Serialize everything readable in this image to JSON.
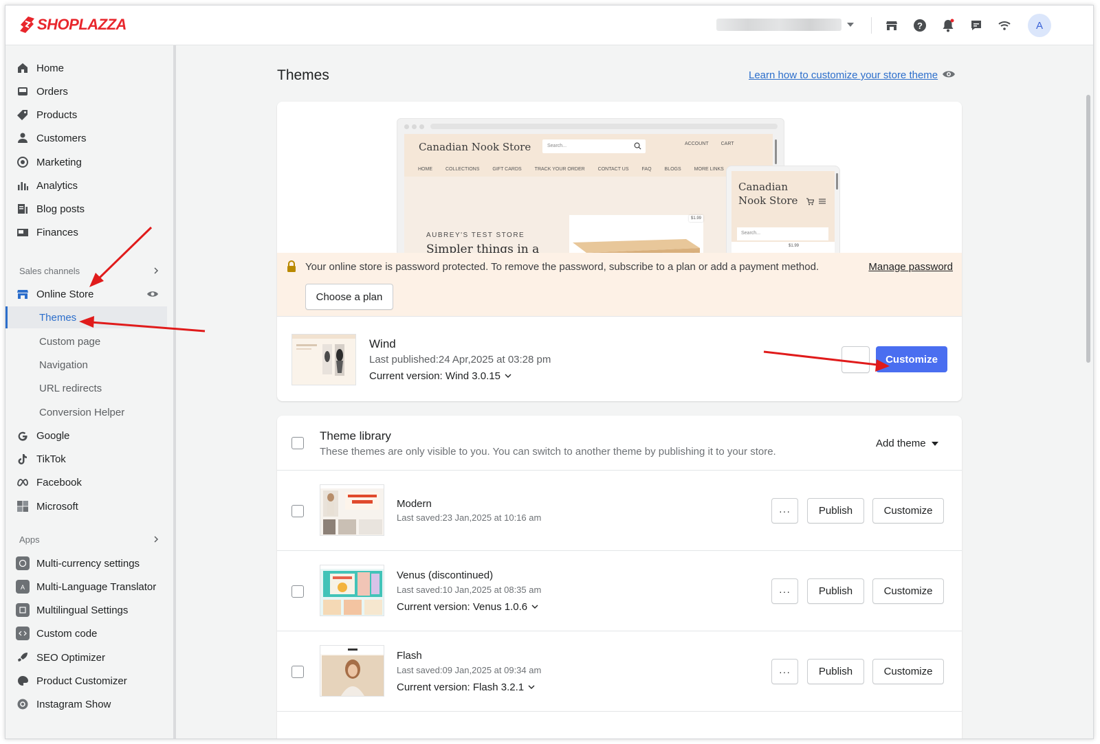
{
  "brand": {
    "name": "SHOPLAZZA",
    "color": "#e8262c"
  },
  "topbar": {
    "avatar_initial": "A",
    "icons": [
      "store-icon",
      "help-icon",
      "bell-icon",
      "chat-icon",
      "wifi-icon"
    ]
  },
  "sidebar": {
    "main_items": [
      {
        "label": "Home",
        "icon": "home-icon"
      },
      {
        "label": "Orders",
        "icon": "orders-icon"
      },
      {
        "label": "Products",
        "icon": "tag-icon"
      },
      {
        "label": "Customers",
        "icon": "person-icon"
      },
      {
        "label": "Marketing",
        "icon": "target-icon"
      },
      {
        "label": "Analytics",
        "icon": "bar-chart-icon"
      },
      {
        "label": "Blog posts",
        "icon": "blog-icon"
      },
      {
        "label": "Finances",
        "icon": "finance-icon"
      }
    ],
    "sales_channels_label": "Sales channels",
    "online_store": "Online Store",
    "sub_items": [
      "Themes",
      "Custom page",
      "Navigation",
      "URL redirects",
      "Conversion Helper"
    ],
    "channels": [
      "Google",
      "TikTok",
      "Facebook",
      "Microsoft"
    ],
    "apps_label": "Apps",
    "apps": [
      "Multi-currency settings",
      "Multi-Language Translator",
      "Multilingual Settings",
      "Custom code",
      "SEO Optimizer",
      "Product Customizer",
      "Instagram Show"
    ]
  },
  "main": {
    "title": "Themes",
    "learn_link": "Learn how to customize your store theme",
    "preview": {
      "store_name": "Canadian Nook Store",
      "search_placeholder": "Search...",
      "account": "ACCOUNT",
      "cart": "CART",
      "nav": [
        "HOME",
        "COLLECTIONS",
        "GIFT CARDS",
        "TRACK YOUR ORDER",
        "CONTACT US",
        "FAQ",
        "BLOGS",
        "MORE LINKS"
      ],
      "hero_label": "AUBREY'S TEST STORE",
      "hero_title": "Simpler things in a",
      "price": "$1.99",
      "mobile_name": "Canadian Nook Store",
      "mobile_search": "Search...",
      "mobile_price": "$1.99"
    },
    "banner": {
      "text": "Your online store is password protected. To remove the password, subscribe to a plan or add a payment method.",
      "manage_link": "Manage password",
      "choose_plan": "Choose a plan"
    },
    "current_theme": {
      "name": "Wind",
      "last_published": "Last published:24 Apr,2025 at 03:28 pm",
      "version": "Current version: Wind 3.0.15",
      "customize": "Customize"
    },
    "library": {
      "title": "Theme library",
      "subtitle": "These themes are only visible to you. You can switch to another theme by publishing it to your store.",
      "add_theme": "Add theme",
      "more_label": "···",
      "publish_label": "Publish",
      "customize_label": "Customize",
      "themes": [
        {
          "name": "Modern",
          "saved": "Last saved:23 Jan,2025 at 10:16 am",
          "version": ""
        },
        {
          "name": "Venus (discontinued)",
          "saved": "Last saved:10 Jan,2025 at 08:35 am",
          "version": "Current version: Venus 1.0.6"
        },
        {
          "name": "Flash",
          "saved": "Last saved:09 Jan,2025 at 09:34 am",
          "version": "Current version: Flash 3.2.1"
        }
      ]
    }
  },
  "colors": {
    "accent": "#2c6ecb",
    "primary_button": "#4a6ef0",
    "annotation_arrow": "#e01b1b",
    "banner_bg": "#fdf1e6"
  }
}
